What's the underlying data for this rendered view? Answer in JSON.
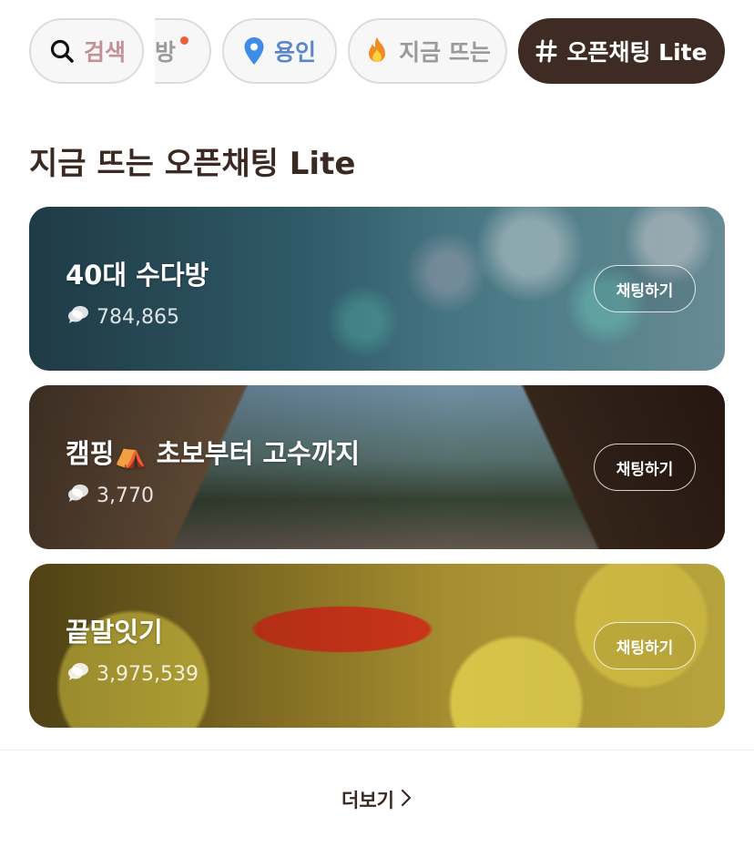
{
  "filters": {
    "search_label": "검색",
    "room_label": "방",
    "region_label": "용인",
    "trending_label": "지금 뜨는",
    "lite_label": "오픈채팅 Lite"
  },
  "section": {
    "title": "지금 뜨는 오픈채팅 Lite"
  },
  "rooms": [
    {
      "title": "40대 수다방",
      "count": "784,865",
      "button": "채팅하기"
    },
    {
      "title": "캠핑⛺ 초보부터 고수까지",
      "count": "3,770",
      "button": "채팅하기"
    },
    {
      "title": "끝말잇기",
      "count": "3,975,539",
      "button": "채팅하기"
    }
  ],
  "footer": {
    "more_label": "더보기"
  },
  "colors": {
    "active_chip_bg": "#3d2b24",
    "search_text": "#c48f95",
    "region_text": "#5b86c9",
    "notification_dot": "#e8603c"
  }
}
